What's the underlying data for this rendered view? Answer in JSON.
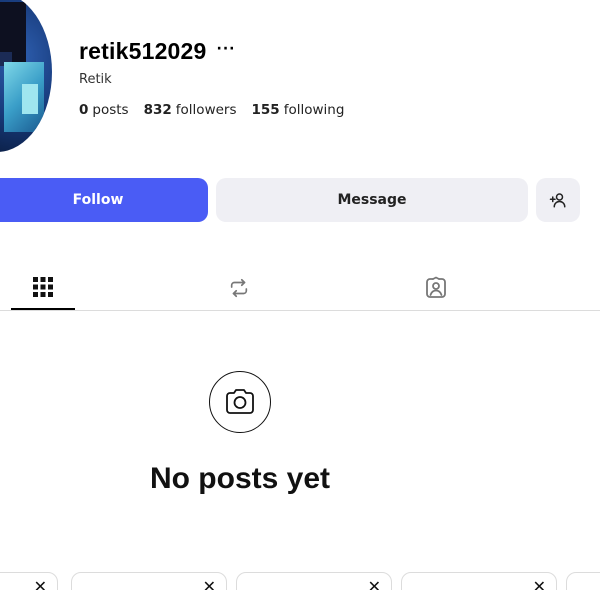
{
  "profile": {
    "username": "retik512029",
    "more_icon": "ellipsis-icon",
    "display_name": "Retik",
    "stats": {
      "posts_count": "0",
      "posts_label": "posts",
      "followers_count": "832",
      "followers_label": "followers",
      "following_count": "155",
      "following_label": "following"
    }
  },
  "actions": {
    "follow_label": "Follow",
    "message_label": "Message",
    "add_user_icon": "add-user-icon"
  },
  "tabs": [
    {
      "name": "grid",
      "icon": "grid-icon",
      "active": true
    },
    {
      "name": "reposts",
      "icon": "repost-icon",
      "active": false
    },
    {
      "name": "tagged",
      "icon": "tagged-person-icon",
      "active": false
    }
  ],
  "empty_state": {
    "icon": "camera-icon",
    "title": "No posts yet"
  },
  "suggestion_cards": [
    {
      "close_icon": "close-icon",
      "close_glyph": "✕"
    },
    {
      "close_icon": "close-icon",
      "close_glyph": "✕"
    },
    {
      "close_icon": "close-icon",
      "close_glyph": "✕"
    },
    {
      "close_icon": "close-icon",
      "close_glyph": "✕"
    }
  ],
  "colors": {
    "accent": "#4a5cf5",
    "secondary_button": "#efeff4",
    "divider": "#dcdcdc"
  }
}
